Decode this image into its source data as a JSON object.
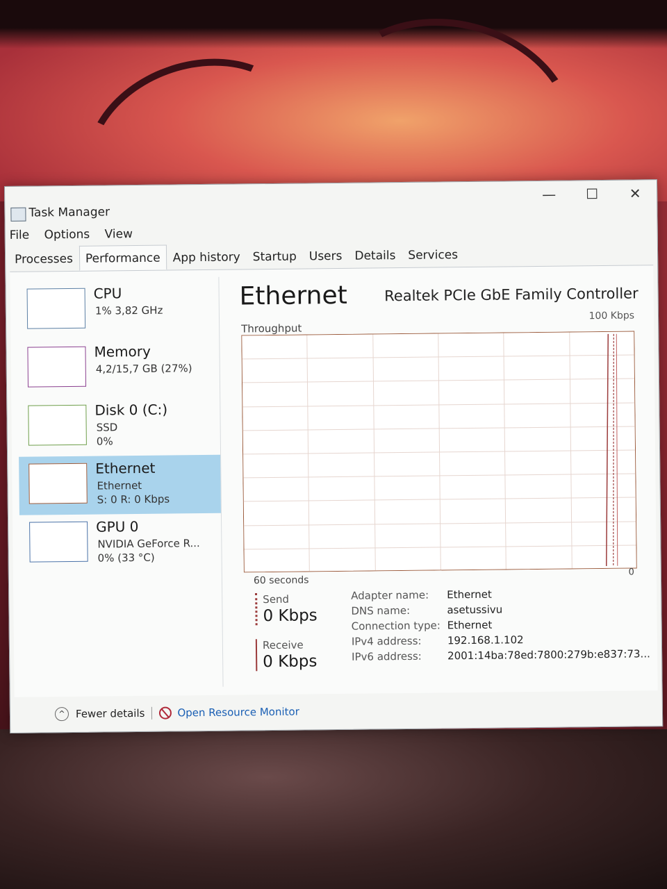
{
  "window": {
    "title": "Task Manager"
  },
  "menu": [
    "File",
    "Options",
    "View"
  ],
  "tabs": [
    {
      "label": "Processes"
    },
    {
      "label": "Performance"
    },
    {
      "label": "App history"
    },
    {
      "label": "Startup"
    },
    {
      "label": "Users"
    },
    {
      "label": "Details"
    },
    {
      "label": "Services"
    }
  ],
  "active_tab": "Performance",
  "sidebar": {
    "cpu": {
      "title": "CPU",
      "line1": "1% 3,82 GHz"
    },
    "memory": {
      "title": "Memory",
      "line1": "4,2/15,7 GB (27%)"
    },
    "disk": {
      "title": "Disk 0 (C:)",
      "line1": "SSD",
      "line2": "0%"
    },
    "ethernet": {
      "title": "Ethernet",
      "line1": "Ethernet",
      "line2": "S: 0 R: 0 Kbps"
    },
    "gpu": {
      "title": "GPU 0",
      "line1": "NVIDIA GeForce R...",
      "line2": "0% (33 °C)"
    }
  },
  "main": {
    "title": "Ethernet",
    "adapter": "Realtek PCIe GbE Family Controller",
    "graph_label": "Throughput",
    "graph_max": "100 Kbps",
    "graph_time": "60 seconds",
    "graph_min": "0",
    "send_label": "Send",
    "send_value": "0 Kbps",
    "receive_label": "Receive",
    "receive_value": "0 Kbps",
    "info": [
      {
        "k": "Adapter name:",
        "v": "Ethernet"
      },
      {
        "k": "DNS name:",
        "v": "asetussivu"
      },
      {
        "k": "Connection type:",
        "v": "Ethernet"
      },
      {
        "k": "IPv4 address:",
        "v": "192.168.1.102"
      },
      {
        "k": "IPv6 address:",
        "v": "2001:14ba:78ed:7800:279b:e837:73..."
      }
    ]
  },
  "footer": {
    "fewer_details": "Fewer details",
    "open_monitor": "Open Resource Monitor"
  },
  "colors": {
    "selected": "#a9d3ec",
    "graph_line": "#9b3b3b",
    "link": "#1a5fb4"
  }
}
